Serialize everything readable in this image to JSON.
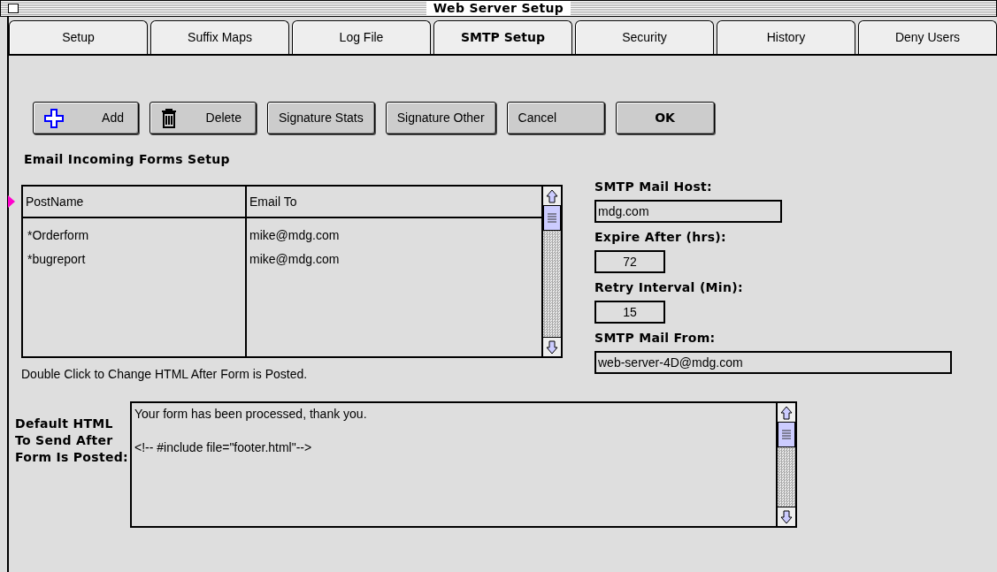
{
  "window": {
    "title": "Web Server Setup"
  },
  "tabs": [
    {
      "label": "Setup",
      "selected": false
    },
    {
      "label": "Suffix Maps",
      "selected": false
    },
    {
      "label": "Log File",
      "selected": false
    },
    {
      "label": "SMTP Setup",
      "selected": true
    },
    {
      "label": "Security",
      "selected": false
    },
    {
      "label": "History",
      "selected": false
    },
    {
      "label": "Deny Users",
      "selected": false
    }
  ],
  "buttons": [
    {
      "label": "Add",
      "kind": "add"
    },
    {
      "label": "Delete",
      "kind": "delete"
    },
    {
      "label": "Signature Stats",
      "kind": "plain"
    },
    {
      "label": "Signature Other",
      "kind": "plain"
    },
    {
      "label": "Cancel",
      "kind": "plain"
    },
    {
      "label": "OK",
      "kind": "default"
    }
  ],
  "forms_table": {
    "title": "Email Incoming Forms Setup",
    "columns": [
      "PostName",
      "Email To"
    ],
    "rows": [
      [
        "*Orderform",
        "mike@mdg.com"
      ],
      [
        "*bugreport",
        "mike@mdg.com"
      ]
    ],
    "note": "Double Click to Change HTML After Form is Posted."
  },
  "fields": [
    {
      "label": "SMTP Mail Host:",
      "value": "mdg.com",
      "kind": "wide"
    },
    {
      "label": "Expire After (hrs):",
      "value": "72",
      "kind": "short"
    },
    {
      "label": "Retry Interval (Min):",
      "value": "15",
      "kind": "short"
    },
    {
      "label": "SMTP Mail From:",
      "value": "web-server-4D@mdg.com",
      "kind": "long"
    }
  ],
  "default_html": {
    "label": "Default HTML To Send After Form Is Posted:",
    "lines": [
      "Your form has been processed, thank you.",
      "<!-- #include file=\"footer.html\"-->"
    ]
  }
}
